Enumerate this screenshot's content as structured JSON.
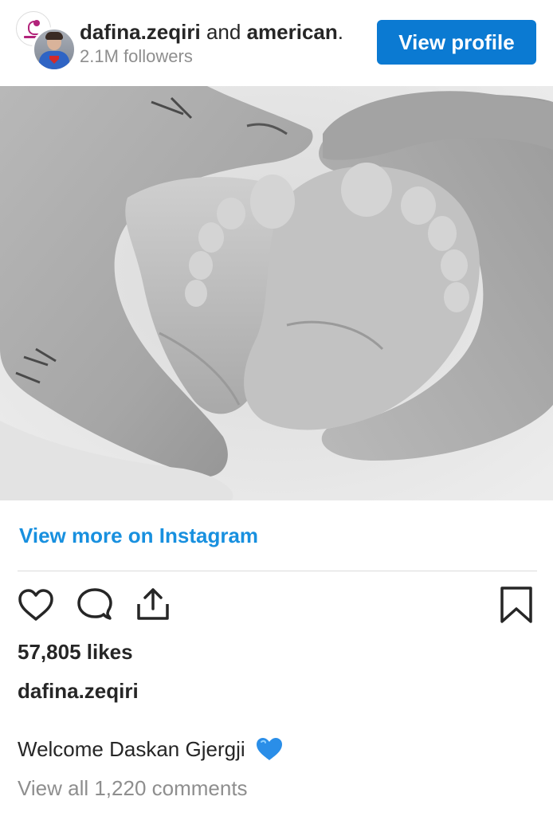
{
  "post": {
    "owner_username": "dafina.zeqiri",
    "owner_joiner": "and",
    "coauthor": "american",
    "coauthor_suffix": ".",
    "followers": "2.1M followers",
    "view_profile_label": "View profile",
    "view_more_label": "View more on Instagram",
    "likes": "57,805 likes",
    "caption_username": "dafina.zeqiri",
    "caption_text": "Welcome Daskan Gjergji",
    "caption_emoji": "blue-heart-icon",
    "comments_link": "View all 1,220 comments"
  },
  "actions": {
    "like": "heart-icon",
    "comment": "comment-icon",
    "share": "share-icon",
    "save": "bookmark-icon"
  },
  "colors": {
    "button_blue": "#0b7ad2",
    "link_blue": "#1890df",
    "text": "#262626",
    "muted": "#8e8e8e",
    "emoji_blue": "#2a8ee8"
  }
}
